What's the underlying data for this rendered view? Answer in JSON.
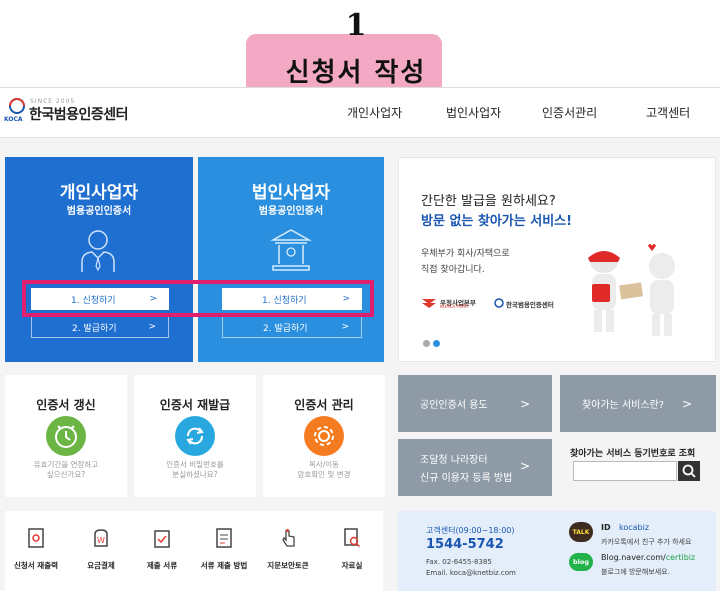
{
  "step": {
    "number": "1",
    "title": "신청서 작성"
  },
  "logo": {
    "since": "SINCE 2005",
    "abbr": "KOCA",
    "name": "한국범용인증센터"
  },
  "nav": [
    "개인사업자",
    "법인사업자",
    "인증서관리",
    "고객센터"
  ],
  "cards": [
    {
      "title": "개인사업자",
      "subtitle": "범용공인인증서",
      "apply": "1. 신청하기",
      "issue": "2. 발급하기",
      "arrow": ">"
    },
    {
      "title": "법인사업자",
      "subtitle": "범용공인인증서",
      "apply": "1. 신청하기",
      "issue": "2. 발급하기",
      "arrow": ">"
    }
  ],
  "promo": {
    "line1": "간단한 발급을 원하세요?",
    "line2": "방문 없는 찾아가는 서비스!",
    "desc1": "우체부가 회사/자택으로",
    "desc2": "직접 찾아갑니다.",
    "partner1": "우정사업본부",
    "partner1_sub": "KOREA POST",
    "partner2": "한국범용인증센터"
  },
  "services": [
    {
      "title": "인증서 갱신",
      "desc1": "유효기간을 연장하고",
      "desc2": "싶으신가요?",
      "color": "#6bb544"
    },
    {
      "title": "인증서 재발급",
      "desc1": "인증서 비밀번호를",
      "desc2": "분실하셨나요?",
      "color": "#29a8e0"
    },
    {
      "title": "인증서 관리",
      "desc1": "복사/이동",
      "desc2": "암호확인 및 변경",
      "color": "#f47b20"
    }
  ],
  "tiles": {
    "usage": "공인인증서 용도",
    "visit": "찾아가는 서비스란?",
    "procure1": "조달청 나라장터",
    "procure2": "신규 이용자 등록 방법",
    "arrow": ">"
  },
  "lookup": {
    "label": "찾아가는 서비스 등기번호로 조회"
  },
  "bottom_links": [
    "신청서 재출력",
    "요금결제",
    "제출 서류",
    "서류 제출 방법",
    "지문보안토큰",
    "자료실"
  ],
  "contact": {
    "label": "고객센터(09:00~18:00)",
    "phone": "1544-5742",
    "fax": "Fax. 02-6455-8385",
    "email": "Email. koca@knetbiz.com",
    "talk_badge": "TALK",
    "talk_id_label": "ID",
    "talk_id": "kocabiz",
    "talk_desc": "카카오톡에서 친구 추가 하세요",
    "blog_badge": "blog",
    "blog_prefix": "Blog.naver.com/",
    "blog_suffix": "certibiz",
    "blog_desc": "블로그에 방문해보세요."
  }
}
